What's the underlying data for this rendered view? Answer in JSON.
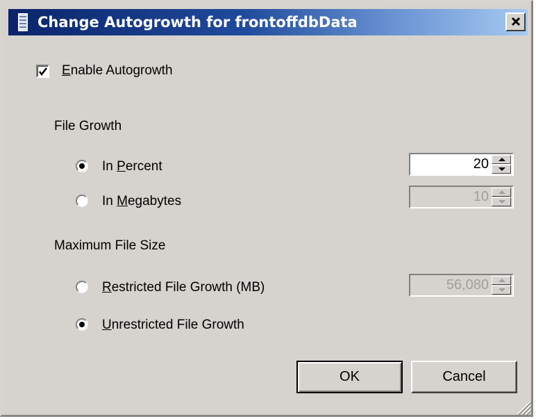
{
  "dialog": {
    "title": "Change Autogrowth for frontoffdbData",
    "close_label": "x"
  },
  "enable_autogrowth": {
    "checked": true,
    "label_first": "E",
    "label_rest": "nable Autogrowth"
  },
  "file_growth": {
    "heading": "File Growth",
    "percent": {
      "selected": true,
      "label_pre": "In ",
      "label_first": "P",
      "label_rest": "ercent",
      "value": "20"
    },
    "megabytes": {
      "selected": false,
      "label_pre": "In ",
      "label_first": "M",
      "label_rest": "egabytes",
      "value": "10"
    }
  },
  "max_file_size": {
    "heading": "Maximum File Size",
    "restricted": {
      "selected": false,
      "label_first": "R",
      "label_rest": "estricted File Growth (MB)",
      "value": "56,080"
    },
    "unrestricted": {
      "selected": true,
      "label_first": "U",
      "label_rest": "nrestricted File Growth"
    }
  },
  "buttons": {
    "ok": "OK",
    "cancel": "Cancel"
  },
  "colors": {
    "dialog_face": "#d6d3ce",
    "title_gradient_start": "#0a246a",
    "title_gradient_end": "#a6caf0",
    "disabled_text": "#a19f99"
  },
  "icons": {
    "title": "document-icon",
    "close": "close-icon",
    "checkmark": "checkmark-icon",
    "resize": "resize-grip-icon"
  }
}
